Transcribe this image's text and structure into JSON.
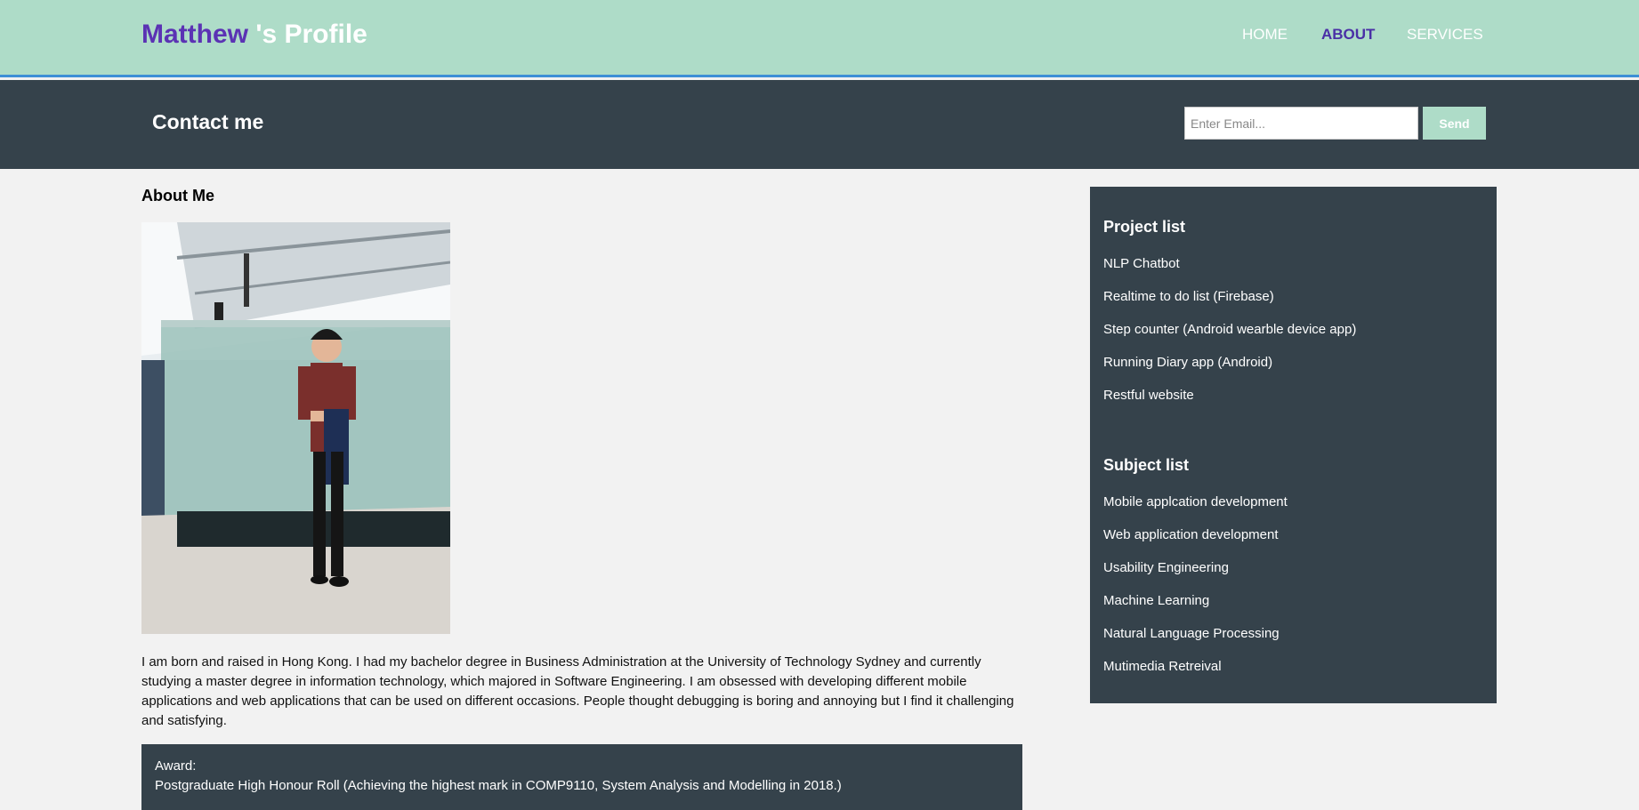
{
  "header": {
    "brand_name": "Matthew",
    "brand_suffix": " 's Profile",
    "nav": {
      "home": "HOME",
      "about": "ABOUT",
      "services": "SERVICES"
    }
  },
  "contact": {
    "title": "Contact me",
    "email_placeholder": "Enter Email...",
    "send_label": "Send"
  },
  "about": {
    "title": "About Me",
    "bio": "I am born and raised in Hong Kong. I had my bachelor degree in Business Administration at the University of Technology Sydney and currently studying a master degree in information technology, which majored in Software Engineering. I am obsessed with developing different mobile applications and web applications that can be used on different occasions. People thought debugging is boring and annoying but I find it challenging and satisfying.",
    "award_label": "Award:",
    "award_text": "Postgraduate High Honour Roll (Achieving the highest mark in COMP9110, System Analysis and Modelling in 2018.)"
  },
  "sidebar": {
    "project_heading": "Project list",
    "projects": [
      "NLP Chatbot",
      "Realtime to do list (Firebase)",
      "Step counter (Android wearble device app)",
      "Running Diary app (Android)",
      "Restful website"
    ],
    "subject_heading": "Subject list",
    "subjects": [
      "Mobile applcation development",
      "Web application development",
      "Usability Engineering",
      "Machine Learning",
      "Natural Language Processing",
      "Mutimedia Retreival"
    ]
  },
  "colors": {
    "header_bg": "#aedcc8",
    "brand_purple": "#5b32b4",
    "dark_panel": "#35424b",
    "page_bg": "#f2f2f2"
  }
}
